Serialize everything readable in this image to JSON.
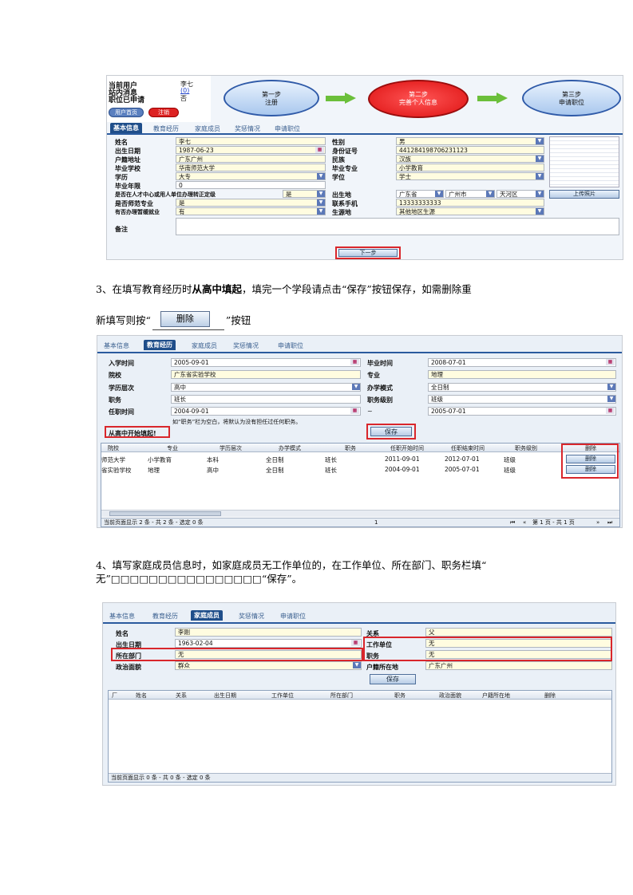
{
  "shot1": {
    "user_labels": [
      "当前用户",
      "站内消息",
      "职位已申请"
    ],
    "user_values": [
      "李七",
      "(0)",
      "否"
    ],
    "btn_homepage": "用户首页",
    "btn_logout": "注销",
    "step1": [
      "第一步",
      "注册"
    ],
    "step2": [
      "第二步",
      "完善个人信息"
    ],
    "step3": [
      "第三步",
      "申请职位"
    ],
    "tabs": [
      "基本信息",
      "教育经历",
      "家庭成员",
      "奖惩情况",
      "申请职位"
    ],
    "left_labels": [
      "姓名",
      "出生日期",
      "户籍地址",
      "毕业学校",
      "学历",
      "毕业年限",
      "是否在人才中心或用人单位办理转正定级",
      "是否师范专业",
      "有否办理暂缓就业",
      "备注"
    ],
    "left_values": [
      "李七",
      "1987-06-23",
      "广东广州",
      "华南师范大学",
      "大专",
      "0",
      "是",
      "是",
      "有"
    ],
    "right_labels": [
      "性别",
      "身份证号",
      "民族",
      "毕业专业",
      "学位",
      "出生地",
      "联系手机",
      "生源地"
    ],
    "right_values": [
      "男",
      "441284198706231123",
      "汉族",
      "小学教育",
      "学士",
      "广东省",
      "广州市",
      "天河区",
      "13333333333",
      "其他地区生源"
    ],
    "upload_photo": "上传照片",
    "next_button": "下一步"
  },
  "para3": {
    "line1_a": "3、在填写教育经历时",
    "line1_bold": "从高中填起",
    "line1_b": "，填完一个学段请点击“保存”按钮保存，如需删除重",
    "line2_a": "新填写则按“",
    "line2_btn": "删除",
    "line2_b": "”按钮"
  },
  "shot2": {
    "tabs": [
      "基本信息",
      "教育经历",
      "家庭成员",
      "奖惩情况",
      "申请职位"
    ],
    "labels_left": [
      "入学时间",
      "院校",
      "学历层次",
      "职务",
      "任职时间"
    ],
    "values_left": [
      "2005-09-01",
      "广东省实验学校",
      "高中",
      "班长",
      "2004-09-01"
    ],
    "labels_right": [
      "毕业时间",
      "专业",
      "办学模式",
      "职务级别",
      "~"
    ],
    "values_right": [
      "2008-07-01",
      "地理",
      "全日制",
      "班级",
      "2005-07-01"
    ],
    "hint": "如“职务”栏为空白，将默认为没有担任过任何职务。",
    "start_note": "从高中开始填起!",
    "save": "保存",
    "headers": [
      "院校",
      "专业",
      "学历层次",
      "办学模式",
      "职务",
      "任职开始时间",
      "任职结束时间",
      "职务级别",
      "删除"
    ],
    "rows": [
      [
        "师范大学",
        "小学教育",
        "本科",
        "全日制",
        "班长",
        "2011-09-01",
        "2012-07-01",
        "班级",
        "删除"
      ],
      [
        "省实验学校",
        "地理",
        "高中",
        "全日制",
        "班长",
        "2004-09-01",
        "2005-07-01",
        "班级",
        "删除"
      ]
    ],
    "pager_left": "当前页面显示 2 条 - 共 2 条 - 选定 0 条",
    "pager_mid": "1",
    "pager_right": "第 1 页 - 共 1 页"
  },
  "para4": {
    "line1": "4、填写家庭成员信息时，如家庭成员无工作单位的，在工作单位、所在部门、职务栏填“",
    "line2": "无”□□□□□□□□□□□□□□□□“保存”。"
  },
  "shot3": {
    "tabs": [
      "基本信息",
      "教育经历",
      "家庭成员",
      "奖惩情况",
      "申请职位"
    ],
    "labels_left": [
      "姓名",
      "出生日期",
      "所在部门",
      "政治面貌"
    ],
    "values_left": [
      "李刚",
      "1963-02-04",
      "无",
      "群众"
    ],
    "labels_right": [
      "关系",
      "工作单位",
      "职务",
      "户籍所在地"
    ],
    "values_right": [
      "父",
      "无",
      "无",
      "广东广州"
    ],
    "save": "保存",
    "headers": [
      "厂",
      "姓名",
      "关系",
      "出生日期",
      "工作单位",
      "所在部门",
      "职务",
      "政治面貌",
      "户籍所在地",
      "删除"
    ],
    "pager_left": "当前页面显示 0 条 - 共 0 条 - 选定 0 条"
  }
}
